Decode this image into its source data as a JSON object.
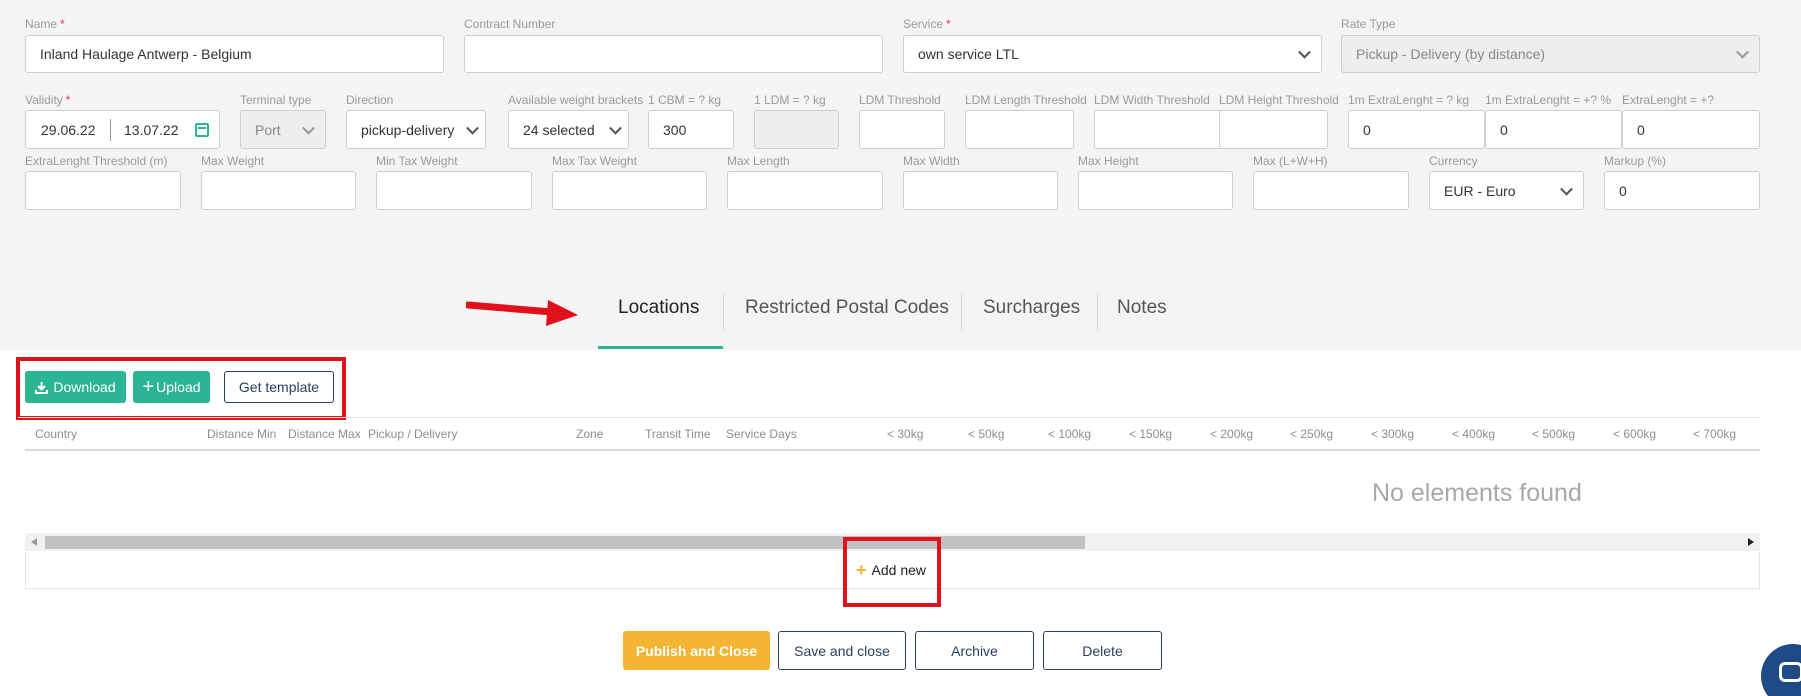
{
  "form": {
    "name": {
      "label": "Name",
      "required": "*",
      "value": "Inland Haulage Antwerp - Belgium"
    },
    "contract_number": {
      "label": "Contract Number",
      "value": ""
    },
    "service": {
      "label": "Service",
      "required": "*",
      "value": "own service LTL"
    },
    "rate_type": {
      "label": "Rate Type",
      "value": "Pickup - Delivery (by distance)"
    },
    "validity": {
      "label": "Validity",
      "required": "*",
      "from": "29.06.22",
      "to": "13.07.22"
    },
    "terminal_type": {
      "label": "Terminal type",
      "value": "Port"
    },
    "direction": {
      "label": "Direction",
      "value": "pickup-delivery"
    },
    "weight_brackets": {
      "label": "Available weight brackets",
      "value": "24 selected"
    },
    "cbm": {
      "label": "1 CBM = ? kg",
      "value": "300"
    },
    "ldm": {
      "label": "1 LDM = ? kg",
      "value": ""
    },
    "ldm_threshold": {
      "label": "LDM Threshold",
      "value": ""
    },
    "ldm_length_threshold": {
      "label": "LDM Length Threshold",
      "value": ""
    },
    "ldm_width_threshold": {
      "label": "LDM Width Threshold",
      "value": ""
    },
    "ldm_height_threshold": {
      "label": "LDM Height Threshold",
      "value": ""
    },
    "extra_length_kg": {
      "label": "1m ExtraLenght = ? kg",
      "value": "0"
    },
    "extra_length_pct": {
      "label": "1m ExtraLenght = +? %",
      "value": "0"
    },
    "extra_length_plus": {
      "label": "ExtraLenght = +?",
      "value": "0"
    },
    "extra_length_threshold": {
      "label": "ExtraLenght Threshold (m)",
      "value": ""
    },
    "max_weight": {
      "label": "Max Weight",
      "value": ""
    },
    "min_tax_weight": {
      "label": "Min Tax Weight",
      "value": ""
    },
    "max_tax_weight": {
      "label": "Max Tax Weight",
      "value": ""
    },
    "max_length": {
      "label": "Max Length",
      "value": ""
    },
    "max_width": {
      "label": "Max Width",
      "value": ""
    },
    "max_height": {
      "label": "Max Height",
      "value": ""
    },
    "max_lwh": {
      "label": "Max (L+W+H)",
      "value": ""
    },
    "currency": {
      "label": "Currency",
      "value": "EUR - Euro"
    },
    "markup": {
      "label": "Markup (%)",
      "value": "0"
    }
  },
  "tabs": [
    {
      "label": "Locations",
      "active": true
    },
    {
      "label": "Restricted Postal Codes"
    },
    {
      "label": "Surcharges"
    },
    {
      "label": "Notes"
    }
  ],
  "toolbar": {
    "download_label": "Download",
    "upload_label": "Upload",
    "template_label": "Get template"
  },
  "table": {
    "columns": [
      "Country",
      "Distance Min",
      "Distance Max",
      "Pickup / Delivery",
      "Zone",
      "Transit Time",
      "Service Days",
      "< 30kg",
      "< 50kg",
      "< 100kg",
      "< 150kg",
      "< 200kg",
      "< 250kg",
      "< 300kg",
      "< 400kg",
      "< 500kg",
      "< 600kg",
      "< 700kg"
    ],
    "empty_message": "No elements found",
    "add_new_label": "Add new"
  },
  "actions": {
    "publish_label": "Publish and Close",
    "save_label": "Save and close",
    "archive_label": "Archive",
    "delete_label": "Delete"
  },
  "colors": {
    "accent_green": "#2bb594",
    "publish_orange": "#f4b534",
    "annotation_red": "#e0111b",
    "navy": "#2b3e5c"
  }
}
